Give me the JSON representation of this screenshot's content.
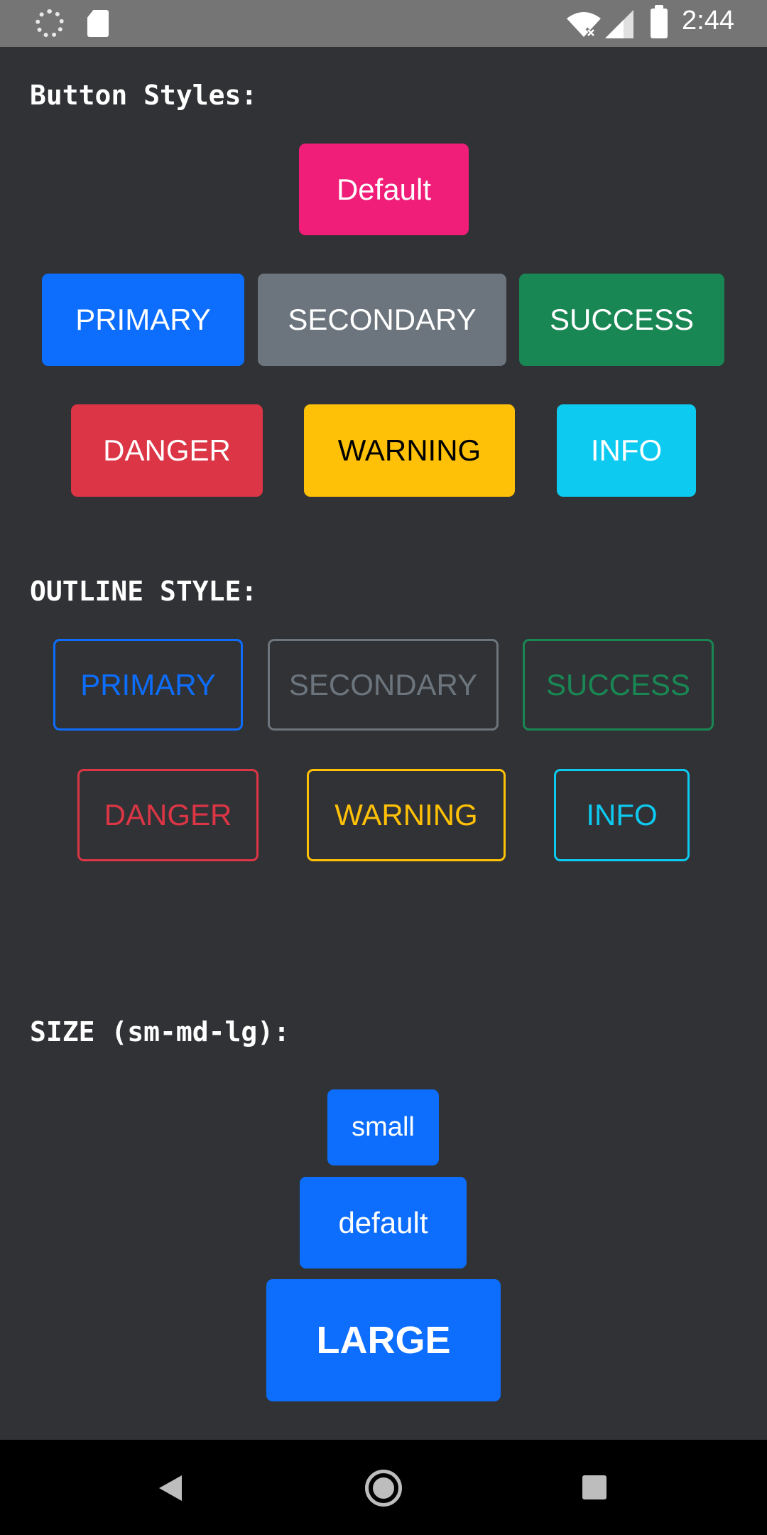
{
  "status_bar": {
    "time": "2:44",
    "icons": [
      "sync-icon",
      "sd-card-icon",
      "wifi-off-icon",
      "signal-icon",
      "battery-icon"
    ]
  },
  "sections": {
    "button_styles": {
      "title": "Button Styles:"
    },
    "outline_style": {
      "title": "OUTLINE STYLE:"
    },
    "size": {
      "title": "SIZE (sm-md-lg):"
    }
  },
  "buttons": {
    "default": {
      "label": "Default",
      "color": "#f01e78"
    },
    "primary": {
      "label": "PRIMARY",
      "color": "#0d6efd"
    },
    "secondary": {
      "label": "SECONDARY",
      "color": "#6c757d"
    },
    "success": {
      "label": "SUCCESS",
      "color": "#198754"
    },
    "danger": {
      "label": "DANGER",
      "color": "#dc3545"
    },
    "warning": {
      "label": "WARNING",
      "color": "#ffc107"
    },
    "info": {
      "label": "INFO",
      "color": "#0dcaf0"
    }
  },
  "outline_buttons": {
    "primary": {
      "label": "PRIMARY",
      "color": "#0d6efd"
    },
    "secondary": {
      "label": "SECONDARY",
      "color": "#6c757d"
    },
    "success": {
      "label": "SUCCESS",
      "color": "#198754"
    },
    "danger": {
      "label": "DANGER",
      "color": "#dc3545"
    },
    "warning": {
      "label": "WARNING",
      "color": "#ffc107"
    },
    "info": {
      "label": "INFO",
      "color": "#0dcaf0"
    }
  },
  "size_buttons": {
    "small": {
      "label": "small"
    },
    "default": {
      "label": "default"
    },
    "large": {
      "label": "LARGE"
    }
  },
  "nav_bar": {
    "icons": [
      "back-icon",
      "home-icon",
      "recents-icon"
    ]
  }
}
